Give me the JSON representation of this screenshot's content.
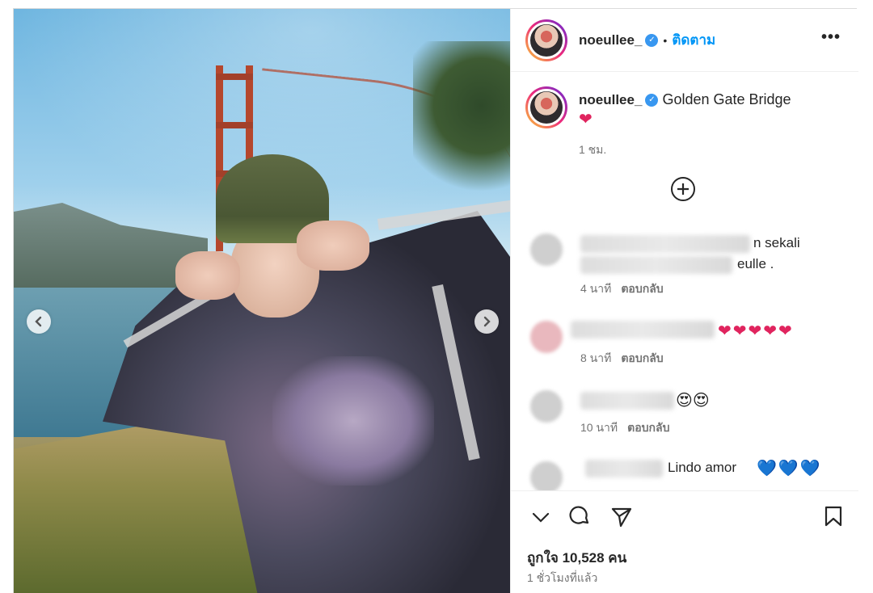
{
  "post": {
    "username": "noeullee_",
    "follow_label": "ติดตาม",
    "dot": "•",
    "more_icon": "more-horizontal-icon"
  },
  "caption": {
    "username": "noeullee_",
    "text": "Golden Gate Bridge",
    "emoji": "❤",
    "time": "1 ชม."
  },
  "comments": [
    {
      "text_line1": "n sekali",
      "text_line2": "eulle .",
      "time": "4 นาที",
      "reply_label": "ตอบกลับ"
    },
    {
      "emoji": "❤❤❤❤❤",
      "time": "8 นาที",
      "reply_label": "ตอบกลับ"
    },
    {
      "emoji": "😍😍",
      "time": "10 นาที",
      "reply_label": "ตอบกลับ"
    },
    {
      "text": "Lindo amor",
      "emoji": "💙💙💙"
    }
  ],
  "footer": {
    "likes_label": "ถูกใจ 10,528 คน",
    "posted_ago": "1 ชั่วโมงที่แล้ว"
  },
  "colors": {
    "accent": "#0095f6",
    "heart_red": "#e0245e",
    "heart_blue": "#1877d6",
    "verified": "#3897f0"
  }
}
